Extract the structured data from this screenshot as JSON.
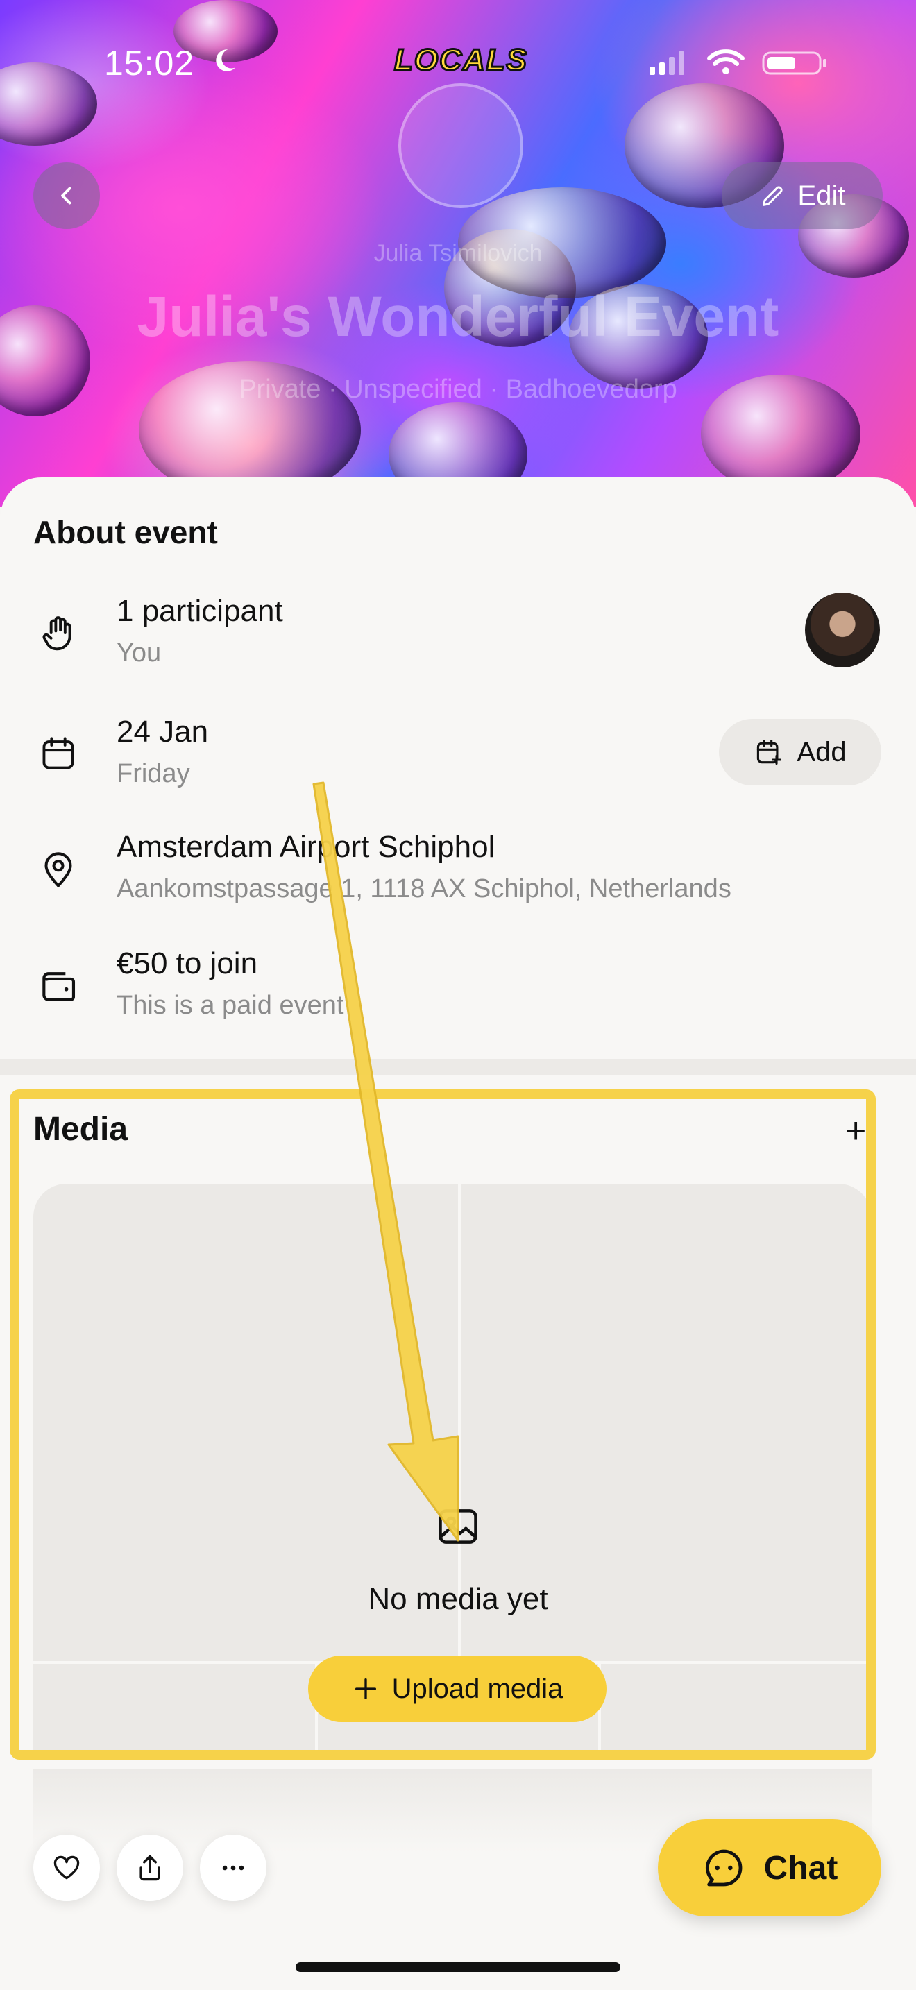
{
  "status_bar": {
    "time": "15:02",
    "brand": "LOCALS"
  },
  "header": {
    "edit_label": "Edit",
    "host_name": "Julia Tsimilovich",
    "event_title": "Julia's Wonderful Event",
    "meta_line": "Private · Unspecified · Badhoevedorp"
  },
  "about": {
    "title": "About event",
    "participants": {
      "main": "1 participant",
      "sub": "You"
    },
    "date": {
      "main": "24 Jan",
      "sub": "Friday",
      "add_label": "Add"
    },
    "location": {
      "main": "Amsterdam Airport Schiphol",
      "sub": "Aankomstpassage 1, 1118 AX Schiphol, Netherlands"
    },
    "price": {
      "main": "€50 to join",
      "sub": "This is a paid event"
    }
  },
  "media": {
    "title": "Media",
    "add_symbol": "+",
    "empty_text": "No media yet",
    "upload_label": "Upload media"
  },
  "footer": {
    "chat_label": "Chat"
  },
  "colors": {
    "accent_yellow": "#f8cf3a",
    "annotation_yellow": "#f6d24a"
  },
  "icons": [
    "back-icon",
    "edit-pencil-icon",
    "wave-hand-icon",
    "calendar-icon",
    "calendar-add-icon",
    "location-pin-icon",
    "wallet-icon",
    "image-icon",
    "plus-icon",
    "heart-icon",
    "share-icon",
    "more-icon",
    "chat-bubble-icon"
  ]
}
